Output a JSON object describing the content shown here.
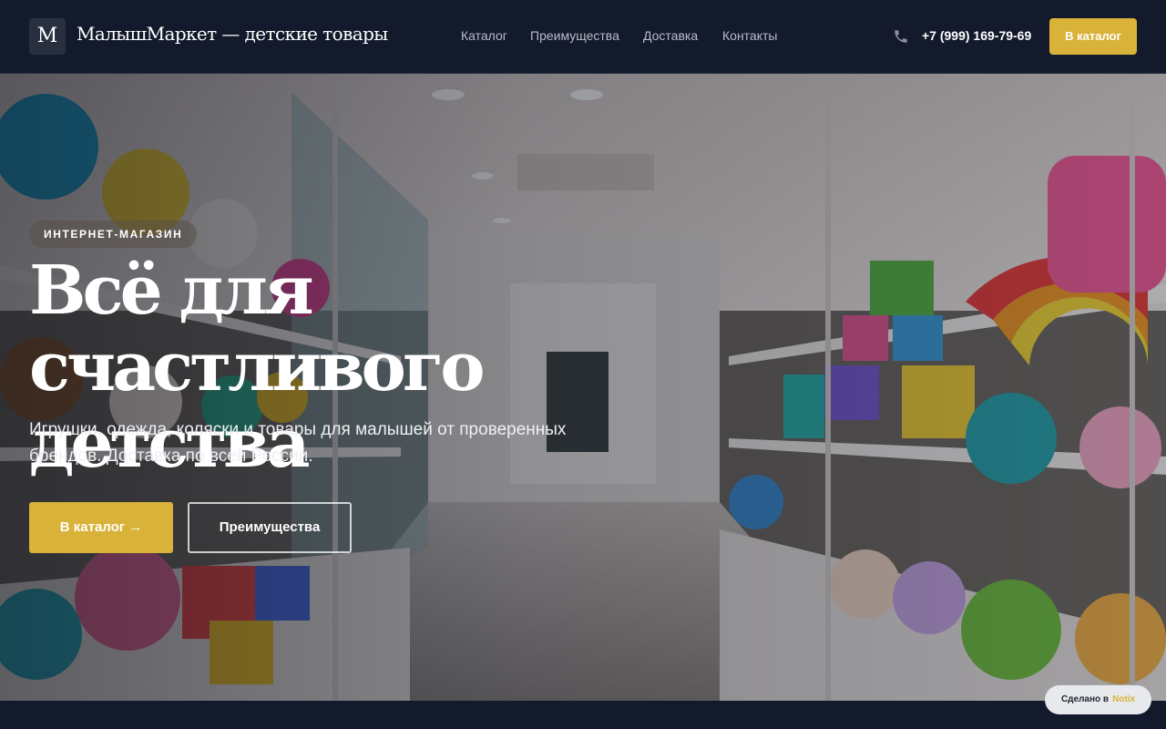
{
  "header": {
    "logo_letter": "M",
    "brand": "МалышМаркет — детские товары",
    "nav": [
      "Каталог",
      "Преимущества",
      "Доставка",
      "Контакты"
    ],
    "phone": "+7 (999) 169-79-69",
    "cta_label": "В каталог"
  },
  "hero": {
    "badge": "ИНТЕРНЕТ-МАГАЗИН",
    "title_line1": "Всё для счастливого",
    "title_line2": "детства",
    "subtitle_line1": "Игрушки, одежда, коляски и товары для малышей от проверенных",
    "subtitle_line2": "брендов. Доставка по всей России.",
    "primary_button": "В каталог →",
    "secondary_button": "Преимущества",
    "image_description_icon": "toy-store-photo"
  },
  "made_with": {
    "label": "Сделано в",
    "brand": "Notix"
  },
  "colors": {
    "accent": "#d9b23a",
    "header_bg": "#121a2c",
    "page_bg": "#111827"
  }
}
